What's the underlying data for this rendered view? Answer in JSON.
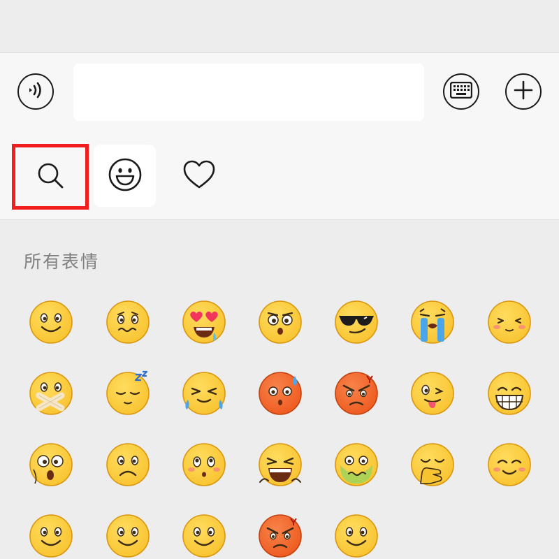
{
  "input_bar": {
    "voice_icon": "voice-waves-icon",
    "text_value": "",
    "keyboard_icon": "keyboard-icon",
    "plus_icon": "plus-icon"
  },
  "tabs": [
    {
      "id": "search",
      "icon": "search-icon",
      "highlighted": true
    },
    {
      "id": "emoji",
      "icon": "smiley-face-icon",
      "selected": true
    },
    {
      "id": "favorites",
      "icon": "heart-icon"
    }
  ],
  "section": {
    "title": "所有表情"
  },
  "emojis": [
    {
      "name": "smile-emoji",
      "face": "smile"
    },
    {
      "name": "grimace-emoji",
      "face": "grimace"
    },
    {
      "name": "heart-eyes-emoji",
      "face": "hearteyes"
    },
    {
      "name": "shocked-emoji",
      "face": "shocked"
    },
    {
      "name": "cool-sunglasses-emoji",
      "face": "cool"
    },
    {
      "name": "crying-emoji",
      "face": "cry"
    },
    {
      "name": "shy-emoji",
      "face": "shy"
    },
    {
      "name": "shut-mouth-emoji",
      "face": "taped"
    },
    {
      "name": "sleepy-emoji",
      "face": "sleepy"
    },
    {
      "name": "tears-of-joy-emoji",
      "face": "squint"
    },
    {
      "name": "embarrassed-sweat-emoji",
      "face": "sweat"
    },
    {
      "name": "angry-emoji",
      "face": "angry"
    },
    {
      "name": "wink-tongue-emoji",
      "face": "wink"
    },
    {
      "name": "big-grin-emoji",
      "face": "grin"
    },
    {
      "name": "surprised-emoji",
      "face": "surprised"
    },
    {
      "name": "sad-emoji",
      "face": "sad"
    },
    {
      "name": "worried-blush-emoji",
      "face": "worried"
    },
    {
      "name": "laughing-emoji",
      "face": "laugh"
    },
    {
      "name": "sick-emoji",
      "face": "sick"
    },
    {
      "name": "hand-on-mouth-emoji",
      "face": "hand"
    },
    {
      "name": "happy-blush-emoji",
      "face": "happy"
    },
    {
      "name": "partial-emoji-1",
      "face": "smile"
    },
    {
      "name": "partial-emoji-2",
      "face": "smile"
    },
    {
      "name": "partial-emoji-3",
      "face": "smile"
    },
    {
      "name": "partial-emoji-4",
      "face": "angry"
    },
    {
      "name": "partial-emoji-5",
      "face": "smile"
    }
  ],
  "colors": {
    "highlight_box": "#f21d1d",
    "emoji_face": "#f8c330",
    "emoji_outline": "#d9960f",
    "angry_face": "#ee5a1f"
  }
}
